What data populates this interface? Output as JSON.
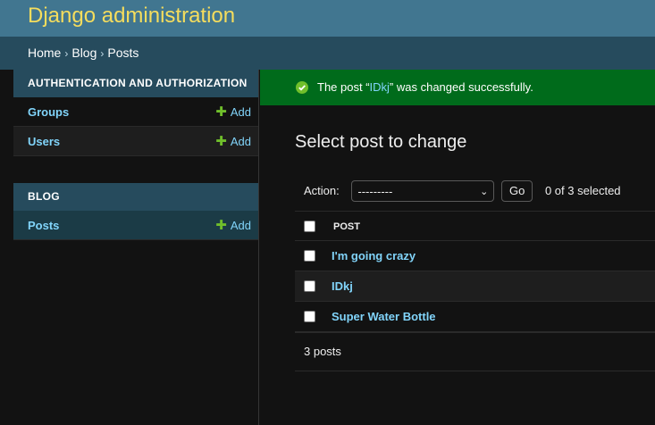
{
  "header": {
    "site_name": "Django administration"
  },
  "breadcrumbs": [
    "Home",
    "Blog",
    "Posts"
  ],
  "breadcrumb_separator": "›",
  "sidebar": {
    "modules": [
      {
        "caption": "AUTHENTICATION AND AUTHORIZATION",
        "models": [
          {
            "label": "Groups",
            "add_label": "Add"
          },
          {
            "label": "Users",
            "add_label": "Add"
          }
        ]
      },
      {
        "caption": "BLOG",
        "models": [
          {
            "label": "Posts",
            "add_label": "Add",
            "selected": true
          }
        ]
      }
    ]
  },
  "message": {
    "prefix": "The post “",
    "link": "IDkj",
    "suffix": "” was changed successfully.",
    "icon": "check-circle-icon"
  },
  "main": {
    "title": "Select post to change",
    "actions": {
      "label": "Action:",
      "selected_value": "---------",
      "go_label": "Go",
      "selected_count": "0 of 3 selected"
    },
    "table": {
      "column_header": "POST",
      "rows": [
        "I'm going crazy",
        "IDkj",
        "Super Water Bottle"
      ]
    },
    "paginator": "3 posts"
  },
  "colors": {
    "header_bg": "#417690",
    "site_name": "#f5dd5d",
    "breadcrumb_bg": "#264b5d",
    "success_bg": "#006b1b",
    "link": "#81d4fa",
    "add_plus": "#70bf2b"
  }
}
